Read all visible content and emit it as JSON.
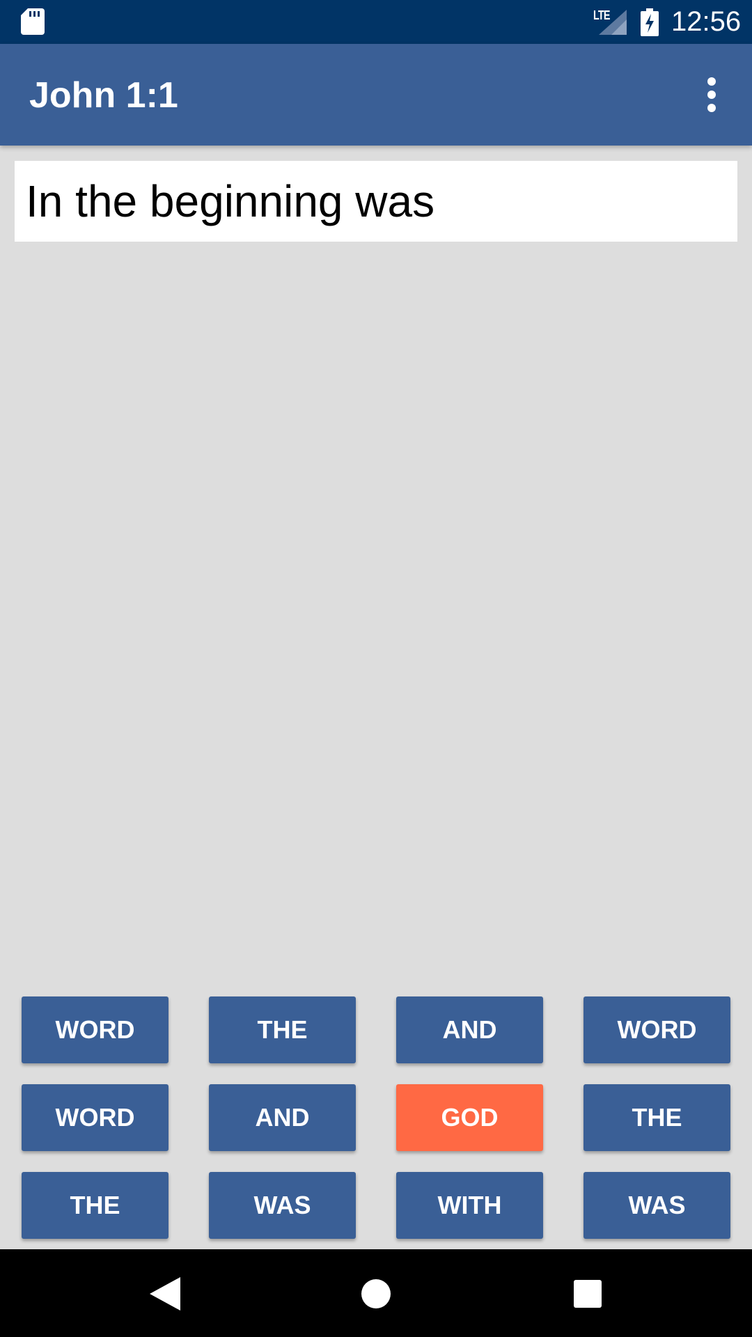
{
  "status_bar": {
    "network": "LTE",
    "time": "12:56",
    "icons": [
      "sd-card-icon",
      "signal-icon",
      "battery-charging-icon"
    ]
  },
  "app_bar": {
    "title": "John 1:1",
    "menu_icon": "more-vert-icon"
  },
  "verse": {
    "text": "In the beginning was"
  },
  "word_buttons": [
    {
      "label": "WORD"
    },
    {
      "label": "THE"
    },
    {
      "label": "AND"
    },
    {
      "label": "WORD"
    },
    {
      "label": "WORD"
    },
    {
      "label": "AND"
    },
    {
      "label": "GOD",
      "highlighted": true
    },
    {
      "label": "THE"
    },
    {
      "label": "THE"
    },
    {
      "label": "WAS"
    },
    {
      "label": "WITH"
    },
    {
      "label": "WAS"
    }
  ],
  "colors": {
    "status_bar": "#013466",
    "app_bar": "#3a5f96",
    "button": "#3a5f96",
    "button_highlight": "#ff6944",
    "background": "#dddddd"
  },
  "nav_bar": {
    "icons": [
      "back-icon",
      "home-icon",
      "recents-icon"
    ]
  }
}
